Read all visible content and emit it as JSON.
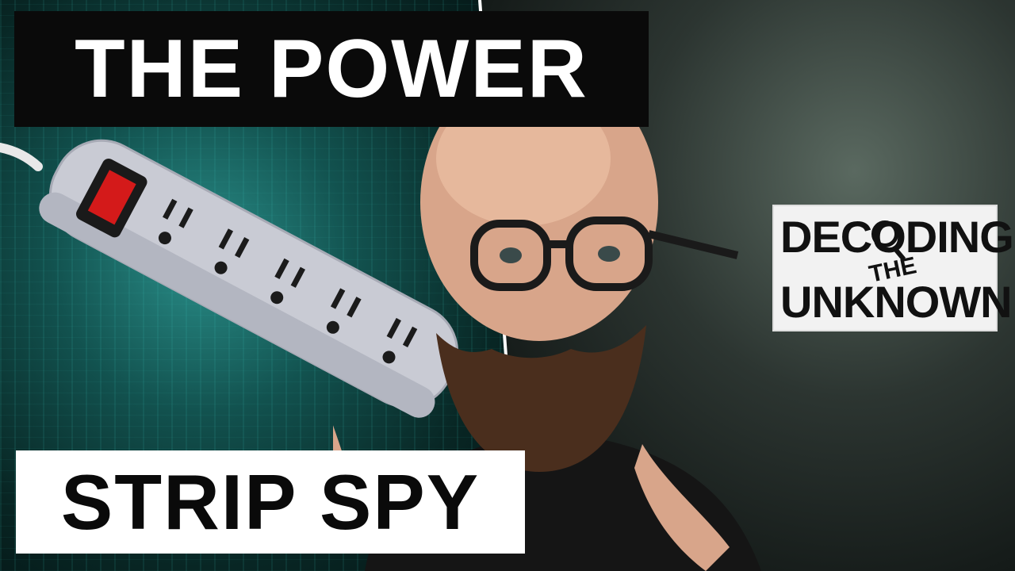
{
  "headline": {
    "top": "THE POWER",
    "bottom": "STRIP SPY"
  },
  "logo": {
    "line1": "DECODING",
    "middle": "THE",
    "line2": "UNKNOWN"
  },
  "colors": {
    "teal_background": "#12524f",
    "power_strip_body": "#c9cbd4",
    "switch_red": "#d41a1a",
    "title_bar_black": "#0a0a0a",
    "title_bar_white": "#ffffff"
  }
}
